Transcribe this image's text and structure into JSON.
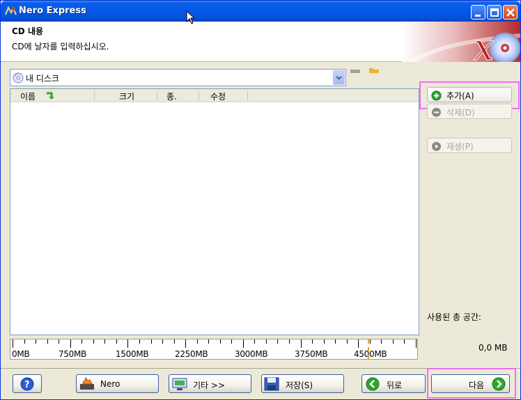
{
  "window": {
    "title": "Nero Express"
  },
  "header": {
    "title": "CD 내용",
    "subtitle": "CD에 날자를 입력하십시오."
  },
  "location": {
    "value": "내 디스크"
  },
  "list": {
    "columns": [
      "이름",
      "크기",
      "종.",
      "수정"
    ],
    "rows": []
  },
  "ruler": {
    "labels": [
      "0MB",
      "750MB",
      "1500MB",
      "2250MB",
      "3000MB",
      "3750MB",
      "4500MB"
    ]
  },
  "actions": {
    "add": "추가(A)",
    "delete": "삭제(D)",
    "play": "재생(P)"
  },
  "stats": {
    "label": "사용된 총 공간:",
    "value": "0,0 MB"
  },
  "footer": {
    "nero": "Nero",
    "more": "기타 >>",
    "save": "저장(S)",
    "back": "뒤로",
    "next": "다음"
  },
  "colors": {
    "titlebar": "#0558e8",
    "highlight": "#f06ff0",
    "accent_green": "#2fa52f"
  }
}
